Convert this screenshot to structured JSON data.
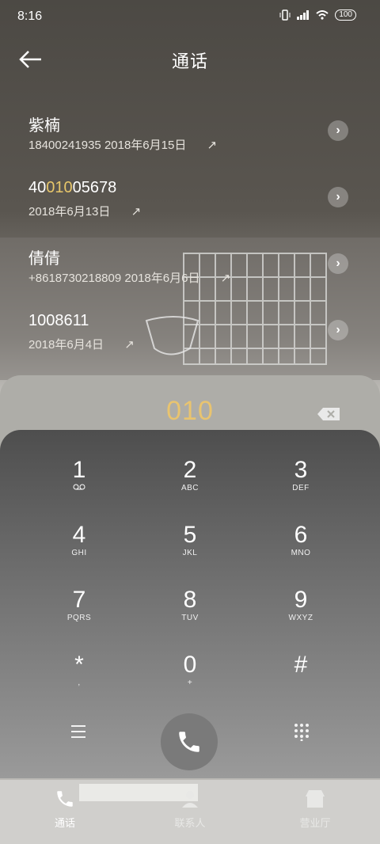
{
  "status": {
    "time": "8:16",
    "battery": "100"
  },
  "header": {
    "title": "通话"
  },
  "calls": [
    {
      "name": "紫楠",
      "number": "18400241935",
      "date": "2018年6月15日"
    },
    {
      "name_pre": "40",
      "name_hl": "010",
      "name_post": "05678",
      "date": "2018年6月13日"
    },
    {
      "name": "倩倩",
      "number": "+8618730218809",
      "date": "2018年6月6日"
    },
    {
      "name": "1008611",
      "date": "2018年6月4日"
    }
  ],
  "dialer": {
    "digits": "010"
  },
  "keys": [
    {
      "d": "1",
      "l": ""
    },
    {
      "d": "2",
      "l": "ABC"
    },
    {
      "d": "3",
      "l": "DEF"
    },
    {
      "d": "4",
      "l": "GHI"
    },
    {
      "d": "5",
      "l": "JKL"
    },
    {
      "d": "6",
      "l": "MNO"
    },
    {
      "d": "7",
      "l": "PQRS"
    },
    {
      "d": "8",
      "l": "TUV"
    },
    {
      "d": "9",
      "l": "WXYZ"
    },
    {
      "d": "*",
      "l": ","
    },
    {
      "d": "0",
      "l": "+"
    },
    {
      "d": "#",
      "l": ""
    }
  ],
  "nav": {
    "calls": "通话",
    "contacts": "联系人",
    "service": "营业厅"
  },
  "colors": {
    "highlight": "#e7c66a",
    "keypad_top": "#4e4e4e",
    "call_button": "#7a7a7a"
  }
}
